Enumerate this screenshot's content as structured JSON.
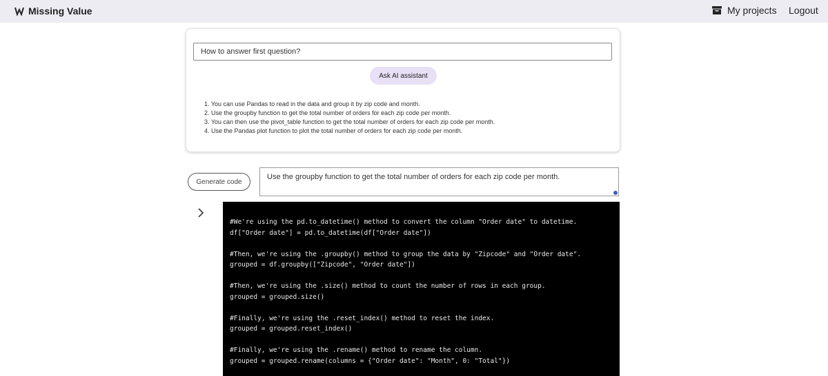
{
  "header": {
    "brand": "Missing Value",
    "my_projects": "My projects",
    "logout": "Logout"
  },
  "assistant": {
    "question_value": "How to answer first question?",
    "ask_button": "Ask AI assistant",
    "answer_lines": [
      "1. You can use Pandas to read in the data and group it by zip code and month.",
      "2. Use the groupby function to get the total number of orders for each zip code per month.",
      "3. You can then use the pivot_table function to get the total number of orders for each zip code per month.",
      "4. Use the Pandas plot function to plot the total number of orders for each zip code per month."
    ]
  },
  "codegen": {
    "generate_button": "Generate code",
    "step_text": "Use the groupby function to get the total number of orders for each zip code per month."
  },
  "code": {
    "lines": [
      "#We're using the pd.to_datetime() method to convert the column \"Order date\" to datetime.",
      "df[\"Order date\"] = pd.to_datetime(df[\"Order date\"])",
      "",
      "#Then, we're using the .groupby() method to group the data by \"Zipcode\" and \"Order date\".",
      "grouped = df.groupby([\"Zipcode\", \"Order date\"])",
      "",
      "#Then, we're using the .size() method to count the number of rows in each group.",
      "grouped = grouped.size()",
      "",
      "#Finally, we're using the .reset_index() method to reset the index.",
      "grouped = grouped.reset_index()",
      "",
      "#Finally, we're using the .rename() method to rename the column.",
      "grouped = grouped.rename(columns = {\"Order date\": \"Month\", 0: \"Total\"})"
    ]
  },
  "icons": {
    "brand": "missing-value-logo",
    "projects": "archive-box-icon",
    "expand": "chevron-right-icon"
  }
}
